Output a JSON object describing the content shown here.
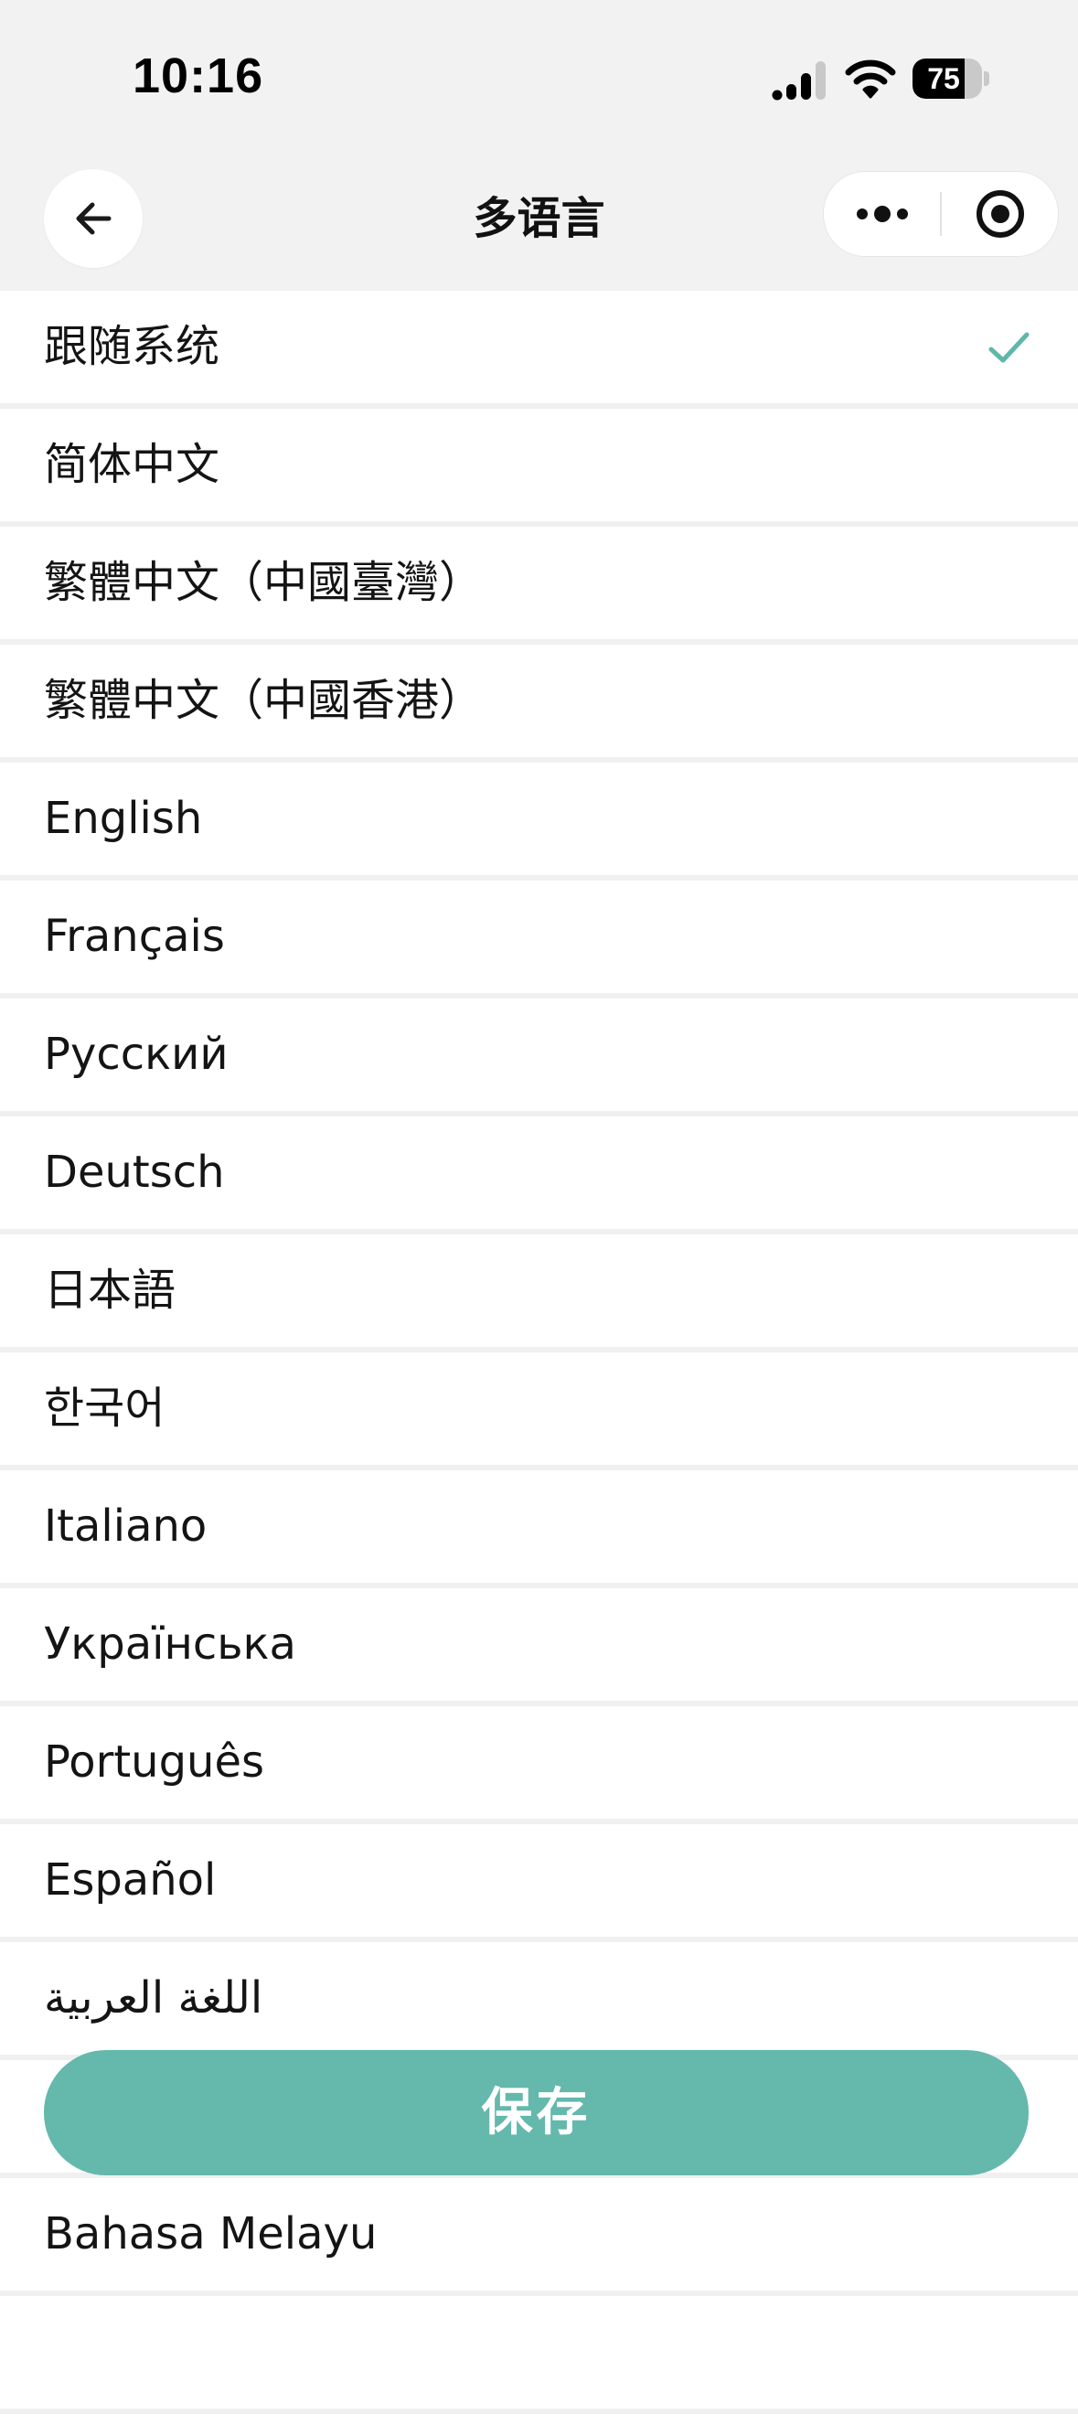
{
  "status_bar": {
    "time": "10:16",
    "battery_level": "75",
    "battery_fraction": 0.75,
    "icons": [
      "signal-icon",
      "wifi-icon",
      "battery-icon"
    ]
  },
  "nav_bar": {
    "title": "多语言",
    "back_icon": "arrow-left-icon",
    "more_icon": "more-dots-icon",
    "close_icon": "target-circle-icon"
  },
  "languages": {
    "selected_index": 0,
    "items": [
      {
        "label": "跟随系统"
      },
      {
        "label": "简体中文"
      },
      {
        "label": "繁體中文（中國臺灣）"
      },
      {
        "label": "繁體中文（中國香港）"
      },
      {
        "label": "English"
      },
      {
        "label": "Français"
      },
      {
        "label": "Русский"
      },
      {
        "label": "Deutsch"
      },
      {
        "label": "日本語"
      },
      {
        "label": "한국어"
      },
      {
        "label": "Italiano"
      },
      {
        "label": "Українська"
      },
      {
        "label": "Português"
      },
      {
        "label": "Español"
      },
      {
        "label": "اللغة العربية"
      },
      {
        "label": ""
      },
      {
        "label": "Bahasa Melayu"
      },
      {
        "label": ""
      }
    ]
  },
  "save_label": "保存",
  "colors": {
    "accent": "#64b8ac",
    "check": "#5fb7aa",
    "header_bg": "#f2f2f2",
    "divider": "#f0f0f0"
  }
}
